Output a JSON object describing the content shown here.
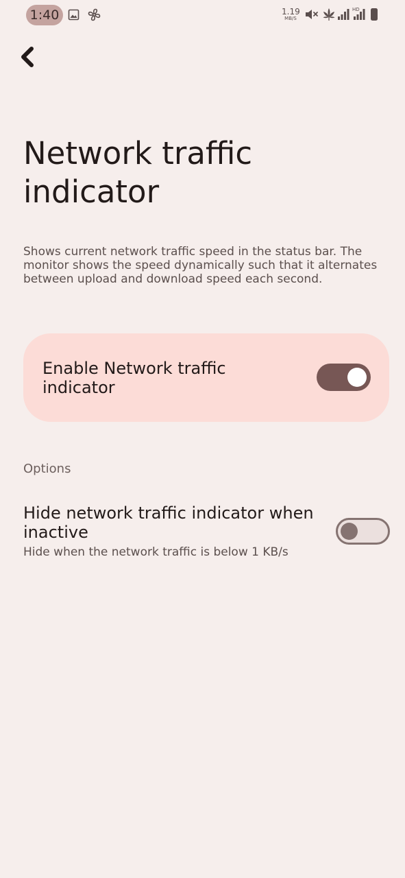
{
  "status_bar": {
    "time": "1:40",
    "net_speed_value": "1.19",
    "net_speed_unit": "MB/S",
    "hd_label": "HD",
    "icons": [
      "gallery-icon",
      "fan-icon",
      "mute-icon",
      "leaf-icon",
      "signal-icon",
      "signal-icon",
      "battery-icon"
    ]
  },
  "header": {
    "back_icon": "chevron-left-icon",
    "title": "Network traffic indicator"
  },
  "description": "Shows current network traffic speed in the status bar. The monitor shows the speed dynamically such that it alternates between upload and download speed each second.",
  "main_toggle": {
    "label": "Enable Network traffic indicator",
    "checked": true,
    "accent": "#775755",
    "card_color": "#fcdcd7"
  },
  "options": {
    "header": "Options",
    "items": [
      {
        "title": "Hide network traffic indicator when inactive",
        "summary": "Hide when the network traffic is below 1 KB/s",
        "checked": false
      }
    ]
  }
}
